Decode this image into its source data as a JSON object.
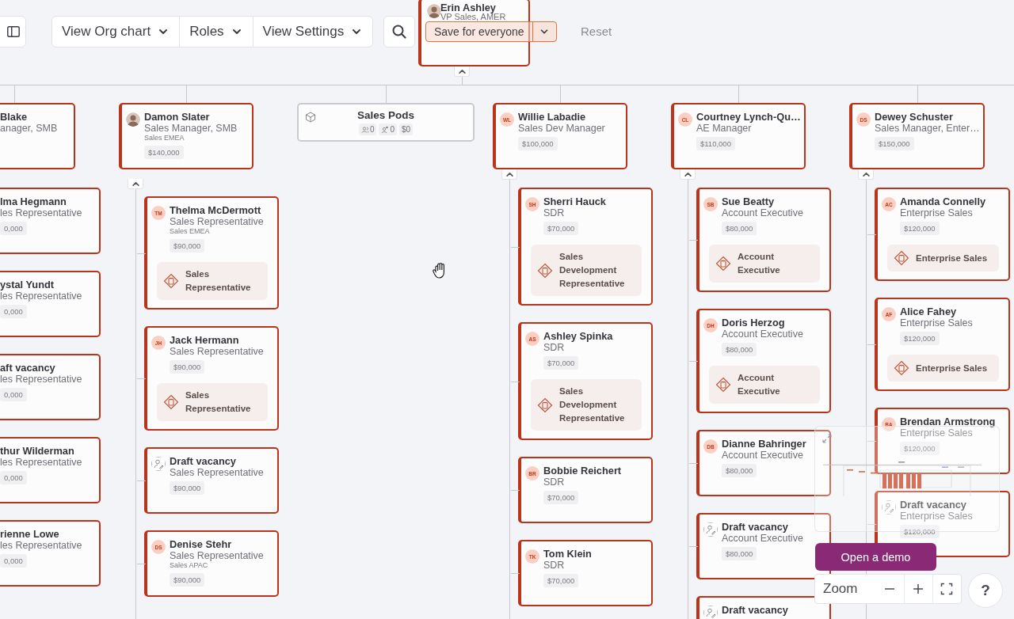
{
  "toolbar": {
    "view_menus": [
      {
        "label": "View Org chart"
      },
      {
        "label": "Roles"
      },
      {
        "label": "View Settings"
      }
    ],
    "save": {
      "label": "Save for everyone"
    },
    "reset": "Reset"
  },
  "root": {
    "kind": "person",
    "name": "Erin Ashley",
    "title": "VP Sales, AMER",
    "avatar": {
      "kind": "photo"
    },
    "expanded": true
  },
  "branches": [
    {
      "manager": {
        "kind": "cut",
        "name": "Blake",
        "title": "anager, SMB"
      },
      "reports": [
        {
          "kind": "cut",
          "name": "lma Hegmann",
          "title": "les Representative",
          "salary": "0,000"
        },
        {
          "kind": "cut",
          "name": "ystal Yundt",
          "title": "les Representative",
          "salary": "0,000"
        },
        {
          "kind": "cut",
          "name": "aft vacancy",
          "title": "les Representative",
          "salary": "0,000"
        },
        {
          "kind": "cut",
          "name": "thur Wilderman",
          "title": "les Representative",
          "salary": "0,000"
        },
        {
          "kind": "cut",
          "name": "rienne Lowe",
          "title": "les Representative",
          "salary": "0,000"
        }
      ]
    },
    {
      "manager": {
        "kind": "person",
        "name": "Damon Slater",
        "title": "Sales Manager, SMB",
        "team": "Sales EMEA",
        "salary": "$140,000",
        "avatar": {
          "kind": "photo"
        },
        "expanded": true
      },
      "reports": [
        {
          "kind": "person",
          "name": "Thelma McDermott",
          "title": "Sales Representative",
          "team": "Sales EMEA",
          "salary": "$90,000",
          "avatar": {
            "kind": "initials",
            "text": "TM"
          },
          "role": "Sales Representative"
        },
        {
          "kind": "person",
          "name": "Jack Hermann",
          "title": "Sales Representative",
          "salary": "$90,000",
          "avatar": {
            "kind": "initials",
            "text": "JH"
          },
          "role": "Sales Representative"
        },
        {
          "kind": "person",
          "name": "Draft vacancy",
          "title": "Sales Representative",
          "salary": "$90,000",
          "avatar": {
            "kind": "vacancy"
          }
        },
        {
          "kind": "person",
          "name": "Denise Stehr",
          "title": "Sales Representative",
          "team": "Sales APAC",
          "salary": "$90,000",
          "avatar": {
            "kind": "initials",
            "text": "DS"
          }
        }
      ]
    },
    {
      "manager": {
        "kind": "pods",
        "name": "Sales Pods",
        "stats": [
          {
            "kind": "members",
            "value": "0"
          },
          {
            "kind": "open",
            "value": "0"
          },
          {
            "kind": "budget",
            "value": "$0"
          }
        ]
      }
    },
    {
      "manager": {
        "kind": "person",
        "name": "Willie Labadie",
        "title": "Sales Dev Manager",
        "salary": "$100,000",
        "avatar": {
          "kind": "initials",
          "text": "WL"
        },
        "expanded": true
      },
      "reports": [
        {
          "kind": "person",
          "name": "Sherri Hauck",
          "title": "SDR",
          "salary": "$70,000",
          "avatar": {
            "kind": "initials",
            "text": "SH"
          },
          "role": "Sales Development Representative"
        },
        {
          "kind": "person",
          "name": "Ashley Spinka",
          "title": "SDR",
          "salary": "$70,000",
          "avatar": {
            "kind": "initials",
            "text": "AS"
          },
          "role": "Sales Development Representative"
        },
        {
          "kind": "person",
          "name": "Bobbie Reichert",
          "title": "SDR",
          "salary": "$70,000",
          "avatar": {
            "kind": "initials",
            "text": "BR"
          }
        },
        {
          "kind": "person",
          "name": "Tom Klein",
          "title": "SDR",
          "salary": "$70,000",
          "avatar": {
            "kind": "initials",
            "text": "TK"
          }
        }
      ]
    },
    {
      "manager": {
        "kind": "person",
        "name": "Courtney Lynch-Qu…",
        "title": "AE Manager",
        "salary": "$110,000",
        "avatar": {
          "kind": "initials",
          "text": "CL"
        },
        "expanded": true
      },
      "reports": [
        {
          "kind": "person",
          "name": "Sue Beatty",
          "title": "Account Executive",
          "salary": "$80,000",
          "avatar": {
            "kind": "initials",
            "text": "SB"
          },
          "role": "Account Executive"
        },
        {
          "kind": "person",
          "name": "Doris Herzog",
          "title": "Account Executive",
          "salary": "$80,000",
          "avatar": {
            "kind": "initials",
            "text": "DH"
          },
          "role": "Account Executive"
        },
        {
          "kind": "person",
          "name": "Dianne Bahringer",
          "title": "Account Executive",
          "salary": "$80,000",
          "avatar": {
            "kind": "initials",
            "text": "DB"
          }
        },
        {
          "kind": "person",
          "name": "Draft vacancy",
          "title": "Account Executive",
          "salary": "$80,000",
          "avatar": {
            "kind": "vacancy"
          }
        },
        {
          "kind": "person",
          "name": "Draft vacancy",
          "avatar": {
            "kind": "vacancy"
          }
        }
      ]
    },
    {
      "manager": {
        "kind": "person",
        "name": "Dewey Schuster",
        "title": "Sales Manager, Enter…",
        "salary": "$150,000",
        "avatar": {
          "kind": "initials",
          "text": "DS"
        },
        "expanded": true
      },
      "reports": [
        {
          "kind": "person",
          "name": "Amanda Connelly",
          "title": "Enterprise Sales",
          "salary": "$120,000",
          "avatar": {
            "kind": "initials",
            "text": "AC"
          },
          "role": "Enterprise Sales"
        },
        {
          "kind": "person",
          "name": "Alice Fahey",
          "title": "Enterprise Sales",
          "salary": "$120,000",
          "avatar": {
            "kind": "initials",
            "text": "AF"
          },
          "role": "Enterprise Sales"
        },
        {
          "kind": "person",
          "name": "Brendan Armstrong",
          "title": "Enterprise Sales",
          "salary": "$120,000",
          "avatar": {
            "kind": "initials",
            "text": "BA"
          }
        },
        {
          "kind": "person",
          "name": "Draft vacancy",
          "title": "Enterprise Sales",
          "salary": "$120,000",
          "avatar": {
            "kind": "vacancy"
          }
        }
      ]
    }
  ],
  "demo_button": "Open a demo",
  "zoom": {
    "label": "Zoom"
  },
  "help": "?"
}
